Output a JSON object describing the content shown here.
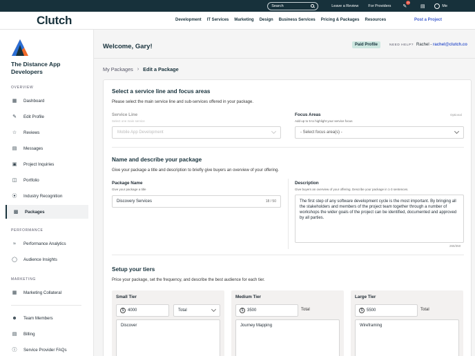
{
  "topbar": {
    "search_placeholder": "Search",
    "leave_review": "Leave a Review",
    "for_providers": "For Providers",
    "notif_count": "15",
    "me": "Me"
  },
  "nav": {
    "logo_text": "Clutch",
    "links": [
      "Development",
      "IT Services",
      "Marketing",
      "Design",
      "Business Services",
      "Pricing & Packages",
      "Resources"
    ],
    "post_project": "Post a Project"
  },
  "sidebar": {
    "company_name": "The Distance App Developers",
    "overview_label": "OVERVIEW",
    "overview_items": [
      {
        "label": "Dashboard",
        "icon": "grid-icon"
      },
      {
        "label": "Edit Profile",
        "icon": "edit-profile-icon"
      },
      {
        "label": "Reviews",
        "icon": "star-icon"
      },
      {
        "label": "Messages",
        "icon": "message-icon"
      },
      {
        "label": "Project Inquiries",
        "icon": "inquiry-icon"
      },
      {
        "label": "Portfolio",
        "icon": "briefcase-icon"
      },
      {
        "label": "Industry Recognition",
        "icon": "award-icon"
      },
      {
        "label": "Packages",
        "icon": "package-icon",
        "active": true
      }
    ],
    "performance_label": "PERFORMANCE",
    "performance_items": [
      {
        "label": "Performance Analytics",
        "icon": "analytics-icon"
      },
      {
        "label": "Audience Insights",
        "icon": "lightbulb-icon"
      }
    ],
    "marketing_label": "MARKETING",
    "marketing_items": [
      {
        "label": "Marketing Collateral",
        "icon": "collateral-icon"
      }
    ],
    "bottom_items": [
      {
        "label": "Team Members",
        "icon": "team-icon"
      },
      {
        "label": "Billing",
        "icon": "billing-icon"
      },
      {
        "label": "Service Provider FAQs",
        "icon": "help-icon"
      }
    ]
  },
  "header": {
    "welcome": "Welcome, Gary!",
    "paid_profile": "Paid Profile",
    "need_help": "NEED HELP?",
    "rachel_name": "Rachel - ",
    "rachel_email": "rachel@clutch.co"
  },
  "breadcrumb": {
    "parent": "My Packages",
    "current": "Edit a Package"
  },
  "service": {
    "title": "Select a service line and focus areas",
    "desc": "Please select the main service line and sub-services offered in your package.",
    "service_line_label": "Service Line",
    "service_line_hint": "Select one main service",
    "service_line_value": "Mobile App Development",
    "focus_label": "Focus Areas",
    "focus_optional": "Optional",
    "focus_hint": "Add up to 5 to highlight your service focus",
    "focus_placeholder": "- Select focus area(s) -"
  },
  "describe": {
    "title": "Name and describe your package",
    "desc": "Give your package a title and description to briefly give buyers an overview of your offering.",
    "name_label": "Package Name",
    "name_hint": "Give your package a title",
    "name_value": "Discovery Services",
    "name_count": "18 / 50",
    "desc_label": "Description",
    "desc_hint": "Give buyers an overview of your offering. Describe your package in 1-3 sentences.",
    "desc_value": "The first step of any software development cycle is the most important. By bringing all the stakeholders and members of the project team together through a number of workshops the wider goals of the project can be identified, documented and approved by all parties.",
    "desc_count": "265/350"
  },
  "tiers": {
    "title": "Setup your tiers",
    "desc": "Price your package, set the frequency, and describe the best audience for each tier.",
    "items": [
      {
        "name": "Small Tier",
        "price": "4000",
        "frequency": "Total",
        "text": "Discover"
      },
      {
        "name": "Medium Tier",
        "price": "3500",
        "frequency": "Total",
        "text": "Journey Mapping"
      },
      {
        "name": "Large Tier",
        "price": "5500",
        "frequency": "Total",
        "text": "Wireframing"
      }
    ]
  },
  "colors": {
    "brand_dark": "#17313b",
    "accent_red": "#e62415",
    "link_blue": "#3d5dce",
    "paid_badge": "#cde7e0"
  }
}
